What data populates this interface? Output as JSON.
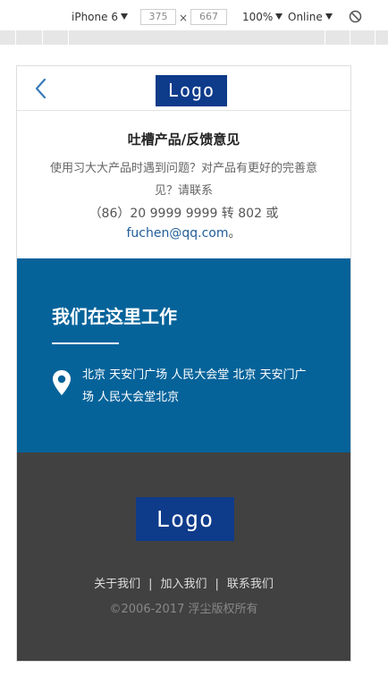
{
  "devtools": {
    "device": "iPhone 6",
    "width": "375",
    "times": "×",
    "height": "667",
    "zoom": "100%",
    "network": "Online"
  },
  "header": {
    "logo_text": "Logo"
  },
  "feedback": {
    "title": "吐槽产品/反馈意见",
    "description": "使用习大大产品时遇到问题？对产品有更好的完善意见？请联系",
    "phone": "（86）20 9999 9999 转 802 或 ",
    "email": "fuchen@qq.com",
    "end": "。"
  },
  "work": {
    "title": "我们在这里工作",
    "address": "北京 天安门广场 人民大会堂 北京 天安门广场 人民大会堂北京"
  },
  "footer": {
    "logo_text": "Logo",
    "links": [
      "关于我们",
      "加入我们",
      "联系我们"
    ],
    "separator": "|",
    "copyright": "©2006-2017 浮尘版权所有"
  },
  "colors": {
    "blue_section": "#05639a",
    "logo_bg": "#0e3b8a",
    "footer_bg": "#414141"
  }
}
